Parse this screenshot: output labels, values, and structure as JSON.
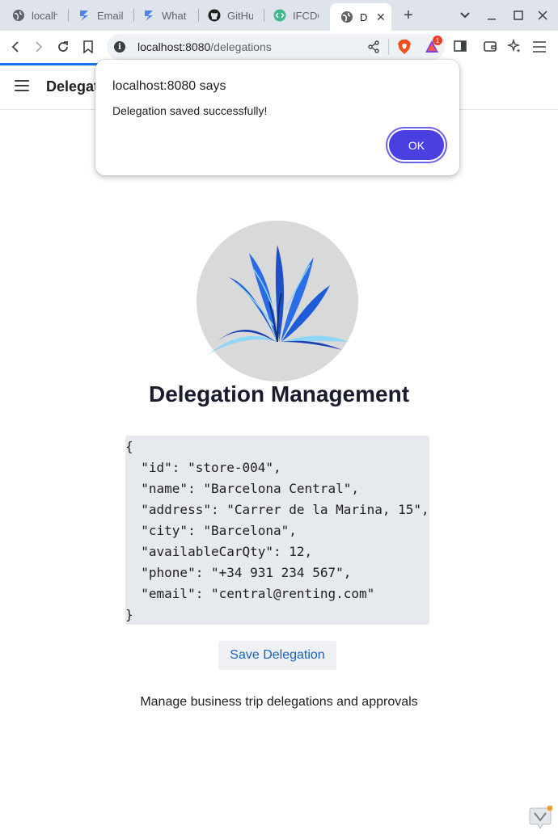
{
  "browser": {
    "tabs": [
      {
        "label": "localh",
        "icon": "globe-icon"
      },
      {
        "label": "Email",
        "icon": "zap-icon"
      },
      {
        "label": "What",
        "icon": "zap-icon"
      },
      {
        "label": "GitHu",
        "icon": "github-icon"
      },
      {
        "label": "IFCDO",
        "icon": "code-icon"
      },
      {
        "label": "D",
        "icon": "globe-icon",
        "active": true
      }
    ],
    "url_host": "localhost:8080",
    "url_path": "/delegations",
    "shields_badge": "1"
  },
  "app": {
    "header_title": "Delegations",
    "title": "Delegation Management",
    "json_lines": [
      "{",
      "  \"id\": \"store-004\",",
      "  \"name\": \"Barcelona Central\",",
      "  \"address\": \"Carrer de la Marina, 15\",",
      "  \"city\": \"Barcelona\",",
      "  \"availableCarQty\": 12,",
      "  \"phone\": \"+34 931 234 567\",",
      "  \"email\": \"central@renting.com\"",
      "}"
    ],
    "save_button": "Save Delegation",
    "subtitle": "Manage business trip delegations and approvals"
  },
  "dialog": {
    "title": "localhost:8080 says",
    "message": "Delegation saved successfully!",
    "ok_label": "OK"
  },
  "colors": {
    "accent": "#4a3fe0",
    "link": "#1565c0",
    "code_bg": "#e6e9ee",
    "logo_bg": "#d9d9d9"
  }
}
